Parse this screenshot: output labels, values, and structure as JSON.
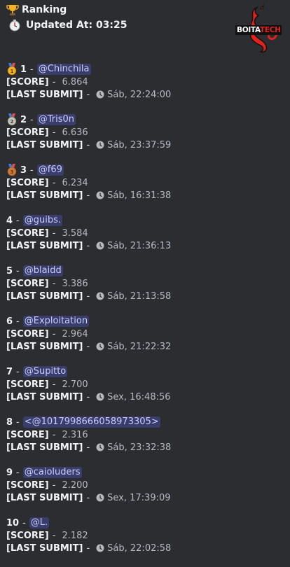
{
  "header": {
    "title": "Ranking",
    "updated": "Updated At: 03:25"
  },
  "logo": {
    "text_left": "BOITA",
    "text_right": "TECH",
    "color": "#e32219"
  },
  "labels": {
    "score": "[SCORE]",
    "last_submit": "[LAST SUBMIT]",
    "dash": "-"
  },
  "entries": [
    {
      "rank": "1",
      "user": "@Chinchila",
      "score": "6.864",
      "last": "Sáb, 22:24:00",
      "medal": "gold"
    },
    {
      "rank": "2",
      "user": "@Tris0n",
      "score": "6.636",
      "last": "Sáb, 23:37:59",
      "medal": "silver"
    },
    {
      "rank": "3",
      "user": "@f69",
      "score": "6.234",
      "last": "Sáb, 16:31:38",
      "medal": "bronze"
    },
    {
      "rank": "4",
      "user": "@guibs.",
      "score": "3.584",
      "last": "Sáb, 21:36:13"
    },
    {
      "rank": "5",
      "user": "@blaidd",
      "score": "3.386",
      "last": "Sáb, 21:13:58"
    },
    {
      "rank": "6",
      "user": "@Exploitation",
      "score": "2.964",
      "last": "Sáb, 21:22:32"
    },
    {
      "rank": "7",
      "user": "@Supitto",
      "score": "2.700",
      "last": "Sex, 16:48:56"
    },
    {
      "rank": "8",
      "user": "<@1017998666058973305>",
      "score": "2.316",
      "last": "Sáb, 23:32:38"
    },
    {
      "rank": "9",
      "user": "@caioluders",
      "score": "2.200",
      "last": "Sex, 17:39:09"
    },
    {
      "rank": "10",
      "user": "@L.",
      "score": "2.182",
      "last": "Sáb, 22:02:58"
    }
  ],
  "colors": {
    "background": "#2b2d31",
    "mention_text": "#c9cdfb",
    "gold": "#f5b324",
    "silver": "#b8c3cc",
    "bronze": "#d0763c"
  }
}
